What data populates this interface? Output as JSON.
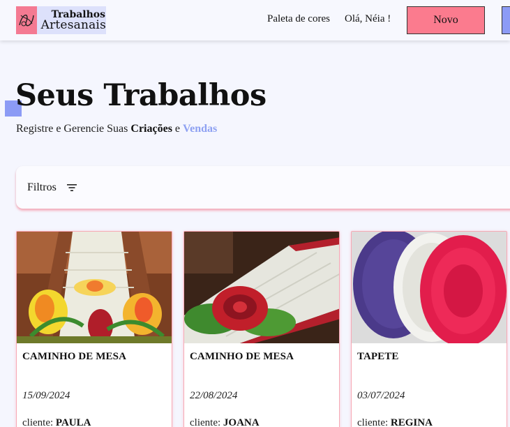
{
  "header": {
    "logo_top": "Trabalhos",
    "logo_bottom": "Artesanais",
    "nav_palette": "Paleta de cores",
    "nav_user": "Olá, Néia !",
    "new_button": "Novo"
  },
  "hero": {
    "title": "Seus Trabalhos",
    "subtitle_prefix": "Registre e Gerencie Suas",
    "subtitle_bold": "Criações",
    "subtitle_conj": "e",
    "subtitle_accent": "Vendas"
  },
  "filters": {
    "label": "Filtros",
    "icon": "filter-icon"
  },
  "colors": {
    "accent_pink": "#fb7b8e",
    "accent_blue": "#8c9bf5",
    "background": "#f5f6fe"
  },
  "cards": [
    {
      "title": "CAMINHO DE MESA",
      "date": "15/09/2024",
      "client_label": "cliente:",
      "client": "PAULA"
    },
    {
      "title": "CAMINHO DE MESA",
      "date": "22/08/2024",
      "client_label": "cliente:",
      "client": "JOANA"
    },
    {
      "title": "TAPETE",
      "date": "03/07/2024",
      "client_label": "cliente:",
      "client": "REGINA"
    }
  ]
}
